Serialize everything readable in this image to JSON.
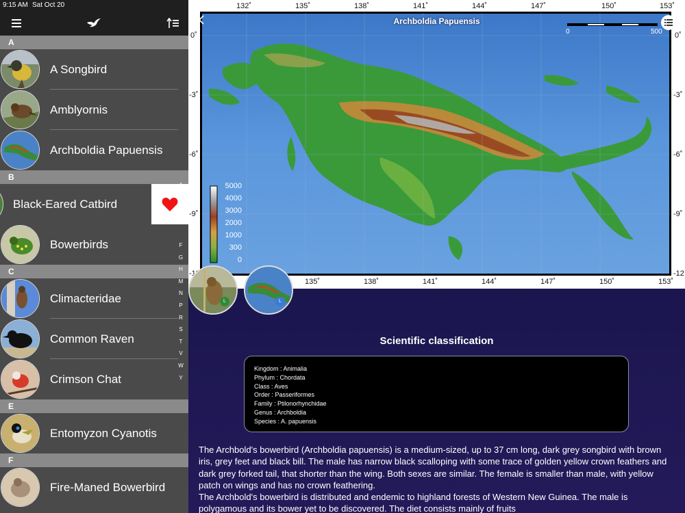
{
  "status_bar": {
    "time": "9:15 AM",
    "date": "Sat Oct 20"
  },
  "nav_bar": {
    "menu_icon": "hamburger-menu-icon",
    "logo_icon": "bird-icon",
    "sort_icon": "sort-list-icon"
  },
  "sections": [
    {
      "letter": "A",
      "items": [
        {
          "name": "A Songbird",
          "thumb": "yellow-songbird"
        },
        {
          "name": "Amblyornis",
          "thumb": "brown-bird"
        },
        {
          "name": "Archboldia Papuensis",
          "thumb": "map"
        }
      ]
    },
    {
      "letter": "B",
      "items": [
        {
          "name": "Black-Eared Catbird",
          "thumb": "green-bird",
          "swiped": true,
          "action_icon": "heart-icon",
          "action_color": "#f01414"
        },
        {
          "name": "Bowerbirds",
          "thumb": "spotted-green-bird"
        }
      ]
    },
    {
      "letter": "C",
      "items": [
        {
          "name": "Climacteridae",
          "thumb": "treecreeper"
        },
        {
          "name": "Common Raven",
          "thumb": "raven"
        },
        {
          "name": "Crimson Chat",
          "thumb": "red-bird"
        }
      ]
    },
    {
      "letter": "E",
      "items": [
        {
          "name": "Entomyzon Cyanotis",
          "thumb": "honeyeater"
        }
      ]
    },
    {
      "letter": "F",
      "items": [
        {
          "name": "Fire-Maned Bowerbird",
          "thumb": "bowerbird"
        }
      ]
    }
  ],
  "index_letters": [
    "A",
    "",
    "",
    "",
    "",
    "F",
    "G",
    "H",
    "M",
    "N",
    "P",
    "R",
    "S",
    "T",
    "V",
    "W",
    "Y"
  ],
  "map": {
    "title": "Archboldia Papuensis",
    "top_ticks": [
      "132˚",
      "135˚",
      "138˚",
      "141˚",
      "144˚",
      "147˚",
      "150˚",
      "153˚"
    ],
    "bottom_ticks": [
      "135˚",
      "138˚",
      "141˚",
      "144˚",
      "147˚",
      "150˚",
      "153˚"
    ],
    "left_ticks": [
      "0˚",
      "-3˚",
      "-6˚",
      "-9˚",
      "-12"
    ],
    "right_ticks": [
      "0˚",
      "-3˚",
      "-6˚",
      "-9˚",
      "-12"
    ],
    "scale_labels": [
      "0",
      "500"
    ],
    "legend_labels": [
      "5000",
      "4000",
      "3000",
      "2000",
      "1000",
      "300",
      "0"
    ],
    "back_icon": "chevron-left-icon",
    "list_icon": "list-icon"
  },
  "gallery": [
    {
      "thumb": "reed-warbler",
      "badge": "L",
      "badge_color": "#2e8b3a"
    },
    {
      "thumb": "map",
      "badge": "L",
      "badge_color": "#3a7bd5"
    }
  ],
  "classification": {
    "title": "Scientific classification",
    "lines": [
      "Kingdom : Animalia",
      "Phylum : Chordata",
      "Class : Aves",
      "Order : Passeriformes",
      "Family : Ptilonorhynchidae",
      "Genus : Archboldia",
      "Species : A. papuensis"
    ]
  },
  "description": {
    "p1": "The Archbold's bowerbird (Archboldia papuensis) is a medium-sized, up to 37 cm long, dark grey songbird with brown iris, grey feet and black bill. The male has narrow black scalloping with some trace of golden yellow crown feathers and dark grey forked tail, that shorter than the wing. Both sexes are similar. The female is smaller than male, with yellow patch on wings and has no crown feathering.",
    "p2": "The Archbold's bowerbird is distributed and endemic to highland forests of Western New Guinea. The male is polygamous and its bower yet to be discovered. The diet consists mainly of fruits"
  }
}
